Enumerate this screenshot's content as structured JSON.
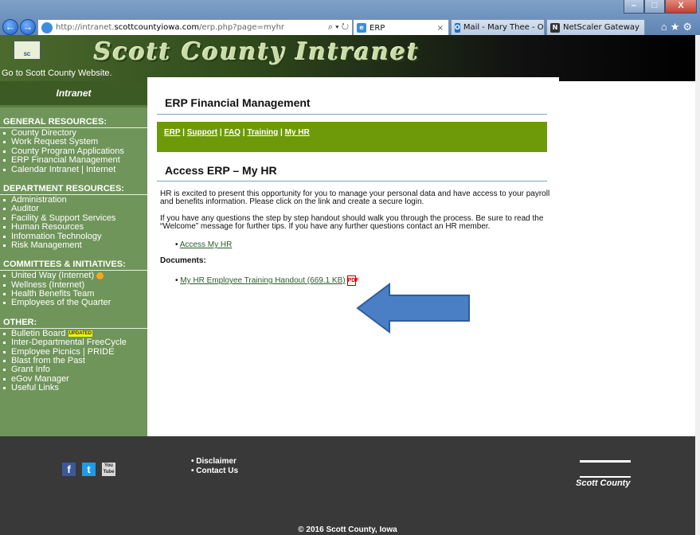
{
  "browser": {
    "url_prefix": "http://intranet.",
    "url_domain": "scottcountyiowa.com",
    "url_path": "/erp.php?page=myhr",
    "address_controls": "⌕ ▾ ↻",
    "tabs": [
      {
        "label": "ERP",
        "active": true
      },
      {
        "label": "Mail - Mary Thee - Out...",
        "active": false
      },
      {
        "label": "NetScaler Gateway",
        "active": false
      }
    ],
    "window_controls": [
      "–",
      "□",
      "X"
    ]
  },
  "header": {
    "site_title": "Scott County Intranet",
    "goto_link": "Go to Scott County Website."
  },
  "sidebar": {
    "heading": "Intranet",
    "sections": [
      {
        "title": "GENERAL RESOURCES:",
        "items": [
          "County Directory",
          "Work Request System",
          "County Program Applications",
          "ERP Financial Management",
          "Calendar Intranet | Internet"
        ]
      },
      {
        "title": "DEPARTMENT RESOURCES:",
        "items": [
          "Administration",
          "Auditor",
          "Facility & Support Services",
          "Human Resources",
          "Information Technology",
          "Risk Management"
        ]
      },
      {
        "title": "COMMITTEES & INITIATIVES:",
        "items": [
          "United Way (Internet)",
          "Wellness (Internet)",
          "Health Benefits Team",
          "Employees of the Quarter"
        ]
      },
      {
        "title": "OTHER:",
        "items": [
          "Bulletin Board",
          "Inter-Departmental FreeCycle",
          "Employee Picnics | PRIDE",
          "Blast from the Past",
          "Grant Info",
          "eGov Manager",
          "Useful Links"
        ]
      }
    ],
    "badge_text": "UPDATED"
  },
  "main": {
    "title": "ERP Financial Management",
    "nav_links": [
      "ERP",
      "Support",
      "FAQ",
      "Training",
      "My HR"
    ],
    "subtitle": "Access ERP – My HR",
    "intro": "HR is excited to present this opportunity for you to manage your personal data and have access to your payroll and benefits information. Please click on the link and create a secure login.",
    "help": "If you have any questions the step by step handout should walk you through the process. Be sure to read the “Welcome” message for further tips. If you have any further questions contact an HR member.",
    "access_link": "Access My HR",
    "documents_label": "Documents:",
    "document_link": "My HR Employee Training Handout (669.1 KB)"
  },
  "footer": {
    "links": [
      "Disclaimer",
      "Contact Us"
    ],
    "logo_text": "Scott County",
    "copyright": "© 2016 Scott County, Iowa"
  },
  "colors": {
    "sidebar_bg": "#70955a",
    "nav_bar": "#6e9a0a",
    "footer_bg": "#393939",
    "arrow": "#4a7fc6"
  },
  "icons": [
    "back-arrow-icon",
    "forward-arrow-icon",
    "ie-icon",
    "outlook-icon",
    "netscaler-icon",
    "home-icon",
    "star-icon",
    "gear-icon",
    "pdf-icon",
    "facebook-icon",
    "twitter-icon",
    "youtube-icon"
  ]
}
